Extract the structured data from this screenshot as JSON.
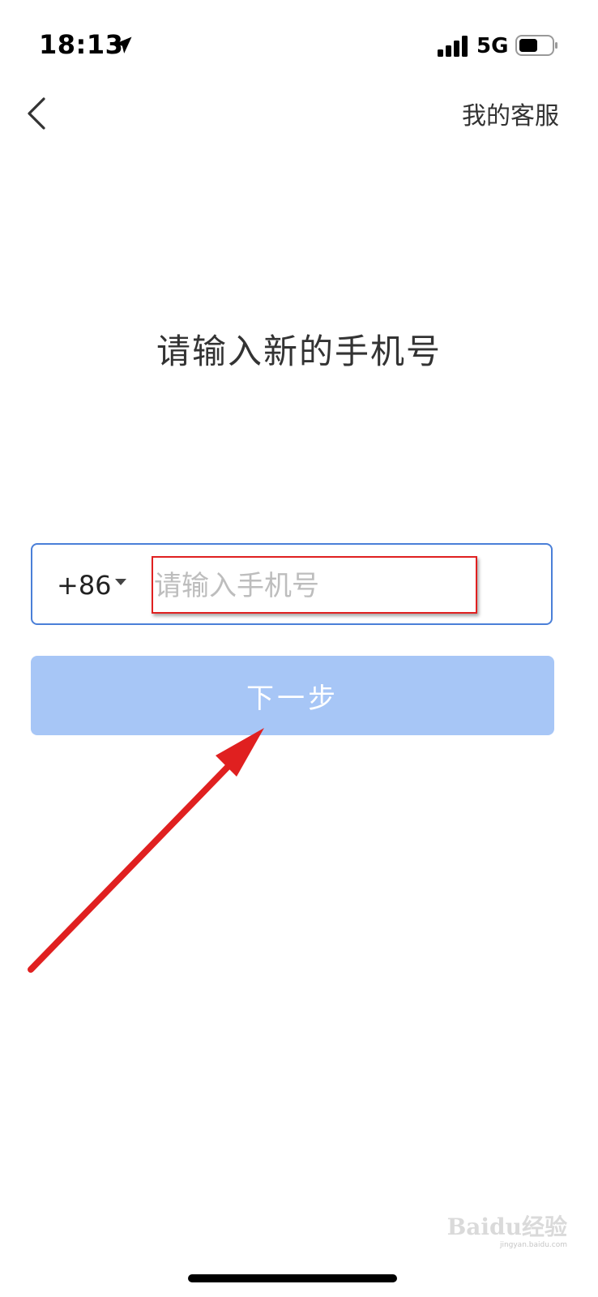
{
  "status_bar": {
    "time": "18:13",
    "network": "5G"
  },
  "nav": {
    "customer_service": "我的客服"
  },
  "main": {
    "title": "请输入新的手机号",
    "country_code": "+86",
    "phone_placeholder": "请输入手机号",
    "phone_value": "",
    "next_label": "下一步"
  },
  "colors": {
    "input_border": "#4a7fd8",
    "button_bg_disabled": "#a7c6f6",
    "annotation_red": "#e02020"
  },
  "watermark": {
    "brand": "Baidu经验",
    "site": "jingyan.baidu.com"
  }
}
